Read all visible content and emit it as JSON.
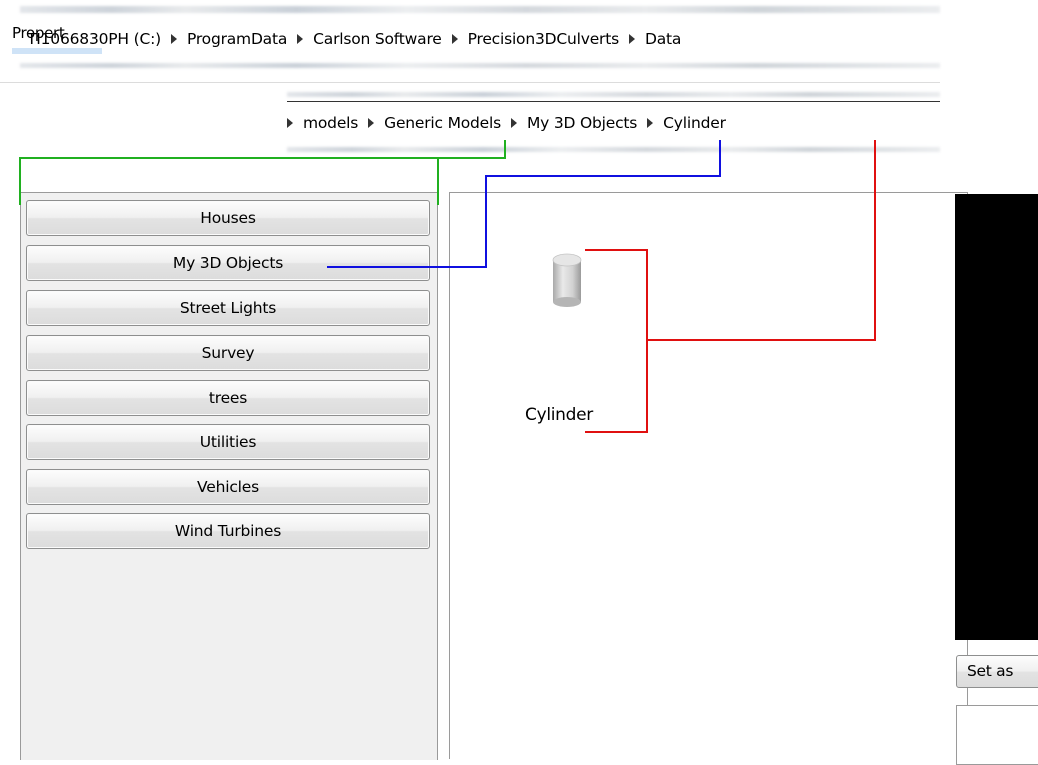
{
  "path_bar": {
    "crumbs": [
      "TI1066830PH (C:)",
      "ProgramData",
      "Carlson Software",
      "Precision3DCulverts",
      "Data"
    ]
  },
  "path_bar_continued": {
    "crumbs": [
      "models",
      "Generic Models",
      "My 3D Objects",
      "Cylinder"
    ]
  },
  "categories": [
    "Houses",
    "My 3D Objects",
    "Street Lights",
    "Survey",
    "trees",
    "Utilities",
    "Vehicles",
    "Wind Turbines"
  ],
  "items": [
    {
      "label": "Cylinder",
      "icon": "cylinder-icon"
    }
  ],
  "preview": {
    "set_button_label": "Set as",
    "properties_label": "Propert"
  },
  "annotation_colors": {
    "generic_models": "#20b020",
    "my_3d_objects": "#1010e0",
    "cylinder": "#e01010"
  }
}
